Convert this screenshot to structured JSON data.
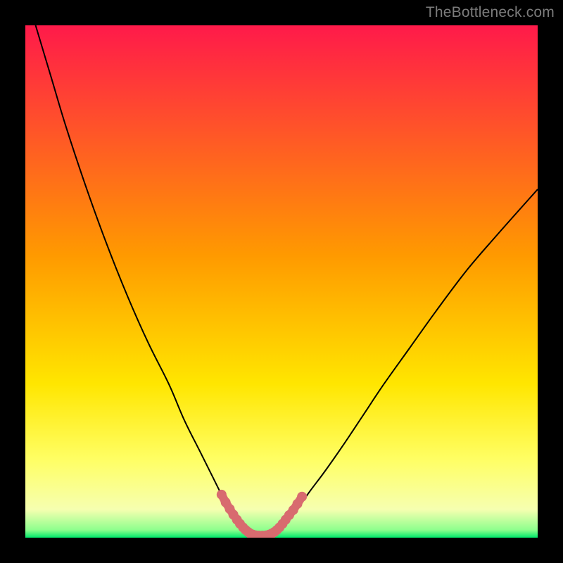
{
  "watermark": "TheBottleneck.com",
  "colors": {
    "page_bg": "#000000",
    "grad_top": "#ff1a4a",
    "grad_mid": "#ffe600",
    "grad_low_yellow": "#ffff66",
    "grad_bottom": "#00e86b",
    "curve": "#000000",
    "marker_line": "#d86b6f",
    "marker_dot": "#d86b6f",
    "watermark": "#7b7b7b"
  },
  "chart_data": {
    "type": "line",
    "title": "",
    "xlabel": "",
    "ylabel": "",
    "xlim": [
      0,
      100
    ],
    "ylim": [
      0,
      100
    ],
    "series": [
      {
        "name": "bottleneck-curve-left",
        "x": [
          2,
          5,
          8,
          12,
          16,
          20,
          24,
          28,
          31,
          34,
          36.5,
          38.5,
          40.2,
          41.6,
          42.6,
          43.3,
          43.8
        ],
        "y": [
          100,
          90,
          80,
          68,
          57,
          47,
          38,
          30,
          23,
          17,
          12,
          8,
          5,
          3,
          1.8,
          1.0,
          0.6
        ]
      },
      {
        "name": "bottleneck-curve-right",
        "x": [
          48.2,
          48.8,
          49.7,
          51,
          53,
          55.5,
          58.5,
          62,
          66,
          70,
          75,
          80,
          86,
          92,
          100
        ],
        "y": [
          0.6,
          1.0,
          1.8,
          3,
          5.5,
          9,
          13,
          18,
          24,
          30,
          37,
          44,
          52,
          59,
          68
        ]
      },
      {
        "name": "bottleneck-floor",
        "x": [
          43.8,
          45,
          46,
          47,
          48.2
        ],
        "y": [
          0.6,
          0.4,
          0.35,
          0.4,
          0.6
        ]
      }
    ],
    "markers": {
      "name": "optimal-range",
      "points": [
        {
          "x": 38.3,
          "y": 8.4
        },
        {
          "x": 39.1,
          "y": 6.9
        },
        {
          "x": 39.9,
          "y": 5.6
        },
        {
          "x": 40.6,
          "y": 4.5
        },
        {
          "x": 41.3,
          "y": 3.5
        },
        {
          "x": 41.9,
          "y": 2.7
        },
        {
          "x": 42.5,
          "y": 2.0
        },
        {
          "x": 43.0,
          "y": 1.5
        },
        {
          "x": 43.5,
          "y": 1.1
        },
        {
          "x": 43.9,
          "y": 0.8
        },
        {
          "x": 44.4,
          "y": 0.6
        },
        {
          "x": 45.0,
          "y": 0.45
        },
        {
          "x": 45.6,
          "y": 0.4
        },
        {
          "x": 46.3,
          "y": 0.4
        },
        {
          "x": 47.0,
          "y": 0.45
        },
        {
          "x": 47.6,
          "y": 0.6
        },
        {
          "x": 48.1,
          "y": 0.8
        },
        {
          "x": 48.6,
          "y": 1.1
        },
        {
          "x": 49.1,
          "y": 1.5
        },
        {
          "x": 49.6,
          "y": 2.0
        },
        {
          "x": 50.2,
          "y": 2.7
        },
        {
          "x": 50.8,
          "y": 3.5
        },
        {
          "x": 51.5,
          "y": 4.4
        },
        {
          "x": 52.3,
          "y": 5.4
        },
        {
          "x": 53.1,
          "y": 6.6
        },
        {
          "x": 54.0,
          "y": 8.0
        }
      ]
    },
    "gradient_stops": [
      {
        "offset": 0.0,
        "color": "#ff1a4a"
      },
      {
        "offset": 0.45,
        "color": "#ff9a00"
      },
      {
        "offset": 0.7,
        "color": "#ffe600"
      },
      {
        "offset": 0.85,
        "color": "#ffff66"
      },
      {
        "offset": 0.945,
        "color": "#f6ffb0"
      },
      {
        "offset": 0.985,
        "color": "#8dff8d"
      },
      {
        "offset": 1.0,
        "color": "#00e86b"
      }
    ]
  }
}
